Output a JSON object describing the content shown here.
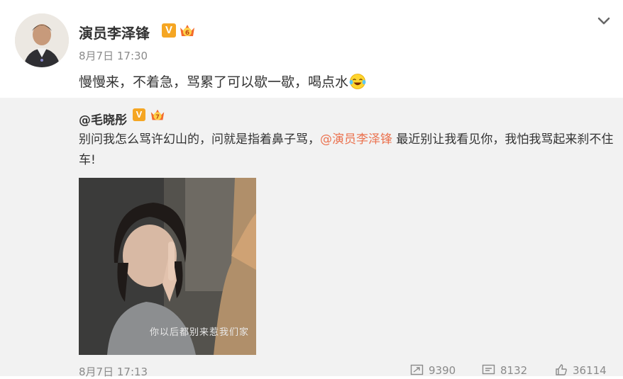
{
  "post": {
    "author": "演员李泽锋",
    "verified_badge": "V",
    "timestamp": "8月7日 17:30",
    "text": "慢慢来，不着急，骂累了可以歇一歇，喝点水",
    "emoji": "laughing-tears-icon"
  },
  "repost": {
    "author": "@毛晓彤",
    "verified_badge": "V",
    "text_before": "别问我怎么骂许幻山的，问就是指着鼻子骂，",
    "mention": "@演员李泽锋",
    "text_after": " 最近别让我看见你，我怕我骂起来刹不住车!",
    "media_caption": "你以后都别来惹我们家",
    "timestamp": "8月7日 17:13",
    "stats": {
      "reposts": "9390",
      "comments": "8132",
      "likes": "36114"
    }
  },
  "colors": {
    "mention": "#eb7350",
    "badge": "#f5a623",
    "repost_bg": "#f2f2f2"
  }
}
